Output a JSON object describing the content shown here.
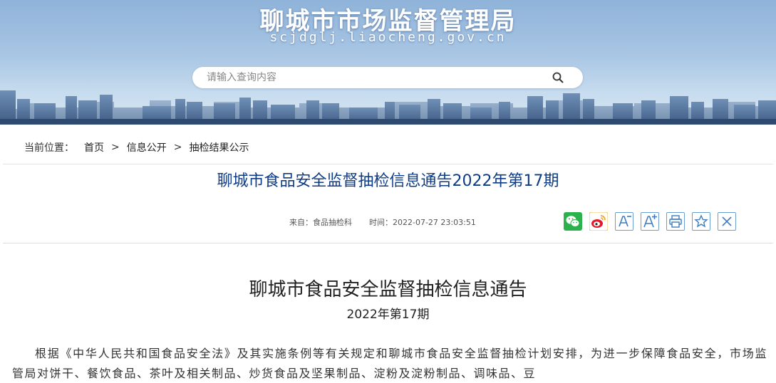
{
  "header": {
    "site_title": "聊城市市场监督管理局",
    "site_domain": "scjdglj.liaocheng.gov.cn",
    "search_placeholder": "请输入查询内容"
  },
  "breadcrumb": {
    "label": "当前位置：",
    "items": [
      "首页",
      "信息公开",
      "抽检结果公示"
    ],
    "separator": ">"
  },
  "article": {
    "title": "聊城市食品安全监督抽检信息通告2022年第17期",
    "source": "来自：食品抽检科",
    "time": "时间：2022-07-27 23:03:51"
  },
  "tools": [
    {
      "icon": "wechat-icon",
      "color": "#2bb24c"
    },
    {
      "icon": "weibo-icon",
      "color": "#e6162d"
    },
    {
      "icon": "font-decrease-icon",
      "glyph": "A"
    },
    {
      "icon": "font-increase-icon",
      "glyph": "A"
    },
    {
      "icon": "print-icon"
    },
    {
      "icon": "favorite-icon"
    },
    {
      "icon": "close-icon"
    }
  ],
  "content": {
    "doc_title": "聊城市食品安全监督抽检信息通告",
    "doc_subtitle": "2022年第17期",
    "paragraph": "根据《中华人民共和国食品安全法》及其实施条例等有关规定和聊城市食品安全监督抽检计划安排，为进一步保障食品安全，市场监管局对饼干、餐饮食品、茶叶及相关制品、炒货食品及坚果制品、淀粉及淀粉制品、调味品、豆"
  },
  "colors": {
    "title_blue": "#0f3c86",
    "tool_border": "#6a9fd3",
    "wechat_green": "#2bb24c",
    "weibo_red": "#e6162d"
  }
}
